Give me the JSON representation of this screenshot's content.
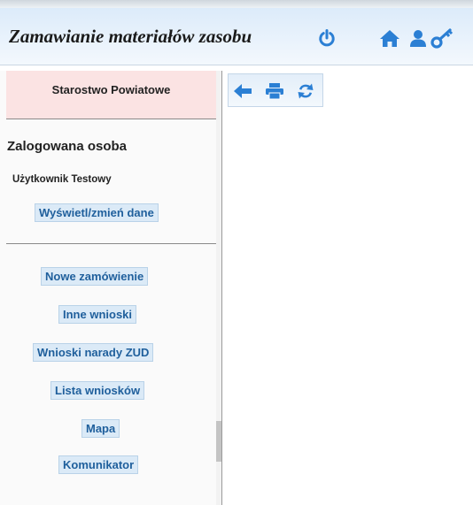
{
  "header": {
    "title": "Zamawianie materiałów zasobu",
    "icons": [
      "power-icon",
      "home-icon",
      "user-icon",
      "key-icon"
    ]
  },
  "sidebar": {
    "organization": "Starostwo Powiatowe",
    "logged_in_label": "Zalogowana osoba",
    "user_name": "Użytkownik Testowy",
    "edit_data_label": "Wyświetl/zmień dane",
    "menu": {
      "new_order": "Nowe zamówienie",
      "other_requests": "Inne wnioski",
      "zud_requests": "Wnioski narady ZUD",
      "request_list": "Lista wniosków",
      "map": "Mapa",
      "messenger": "Komunikator"
    }
  },
  "toolbar": {
    "icons": [
      "back-arrow-icon",
      "print-icon",
      "refresh-icon"
    ]
  },
  "colors": {
    "accent": "#2b7fd4",
    "button_bg": "#dbeaf7",
    "button_text": "#1f5f9c",
    "org_bg": "#fbe3e3"
  }
}
